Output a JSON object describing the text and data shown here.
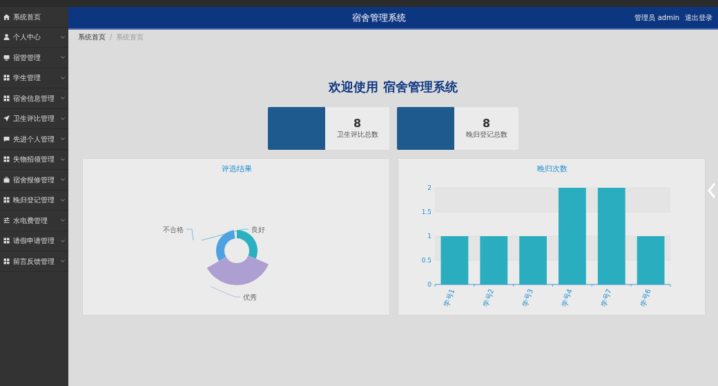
{
  "header": {
    "title": "宿舍管理系统",
    "user": "管理员 admin",
    "logout": "退出登录"
  },
  "sidebar": {
    "items": [
      {
        "label": "系统首页",
        "kind": "home",
        "expandable": false
      },
      {
        "label": "个人中心",
        "kind": "user",
        "expandable": true
      },
      {
        "label": "宿管管理",
        "kind": "monitor",
        "expandable": true
      },
      {
        "label": "学生管理",
        "kind": "grid",
        "expandable": true
      },
      {
        "label": "宿舍信息管理",
        "kind": "grid",
        "expandable": true
      },
      {
        "label": "卫生评比管理",
        "kind": "send",
        "expandable": true
      },
      {
        "label": "先进个人管理",
        "kind": "chat",
        "expandable": true
      },
      {
        "label": "失物招领管理",
        "kind": "grid",
        "expandable": true
      },
      {
        "label": "宿舍报修管理",
        "kind": "briefcase",
        "expandable": true
      },
      {
        "label": "晚归登记管理",
        "kind": "grid",
        "expandable": true
      },
      {
        "label": "水电费管理",
        "kind": "sliders",
        "expandable": true
      },
      {
        "label": "请假申请管理",
        "kind": "grid",
        "expandable": true
      },
      {
        "label": "留言反馈管理",
        "kind": "grid",
        "expandable": true
      }
    ]
  },
  "breadcrumb": {
    "items": [
      "系统首页",
      "系统首页"
    ],
    "separator": "/"
  },
  "welcome": "欢迎使用 宿舍管理系统",
  "stats": [
    {
      "value": "8",
      "label": "卫生评比总数"
    },
    {
      "value": "8",
      "label": "晚归登记总数"
    }
  ],
  "rose_panel": {
    "title": "评选结果",
    "labels": [
      {
        "name": "良好",
        "color": "#2ab0bf"
      },
      {
        "name": "优秀",
        "color": "#ad9fd1"
      },
      {
        "name": "不合格",
        "color": "#4fa2e0"
      }
    ]
  },
  "bar_panel": {
    "chart_data": {
      "type": "bar",
      "title": "晚归次数",
      "categories": [
        "学号1",
        "学号2",
        "学号3",
        "学号4",
        "学号7",
        "学号6"
      ],
      "values": [
        1,
        1,
        1,
        2,
        2,
        1
      ],
      "ylim": [
        0,
        2
      ],
      "yticks": [
        0,
        0.5,
        1,
        1.5,
        2
      ]
    }
  }
}
